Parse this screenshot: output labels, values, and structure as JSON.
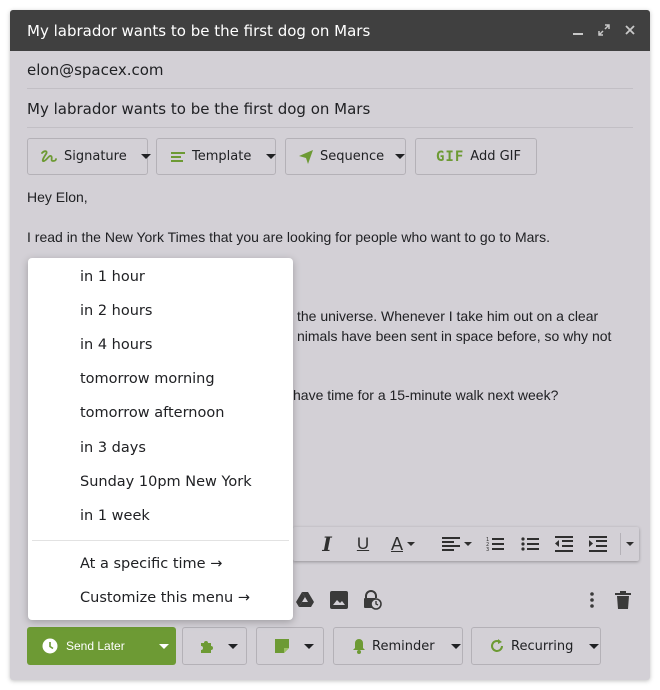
{
  "window": {
    "title": "My labrador wants to be the first dog on Mars",
    "controls": [
      "minimize-icon",
      "expand-icon",
      "close-icon"
    ]
  },
  "compose": {
    "to": "elon@spacex.com",
    "subject": "My labrador wants to be the first dog on Mars"
  },
  "toolbar": {
    "signature_label": "Signature",
    "template_label": "Template",
    "sequence_label": "Sequence",
    "gif_badge": "GIF",
    "add_gif_label": "Add GIF"
  },
  "body": {
    "greeting": "Hey Elon,",
    "line1": "I read in the New York Times that you are looking for people who want to go to Mars.",
    "line2_visible": "the universe. Whenever I take him out on a clear",
    "line3_visible": "nimals have been sent in space before, so why not",
    "line4_visible": "have time for a 15-minute walk next week?"
  },
  "send_later_menu": {
    "items": [
      "in 1 hour",
      "in 2 hours",
      "in 4 hours",
      "tomorrow morning",
      "tomorrow afternoon",
      "in 3 days",
      "Sunday 10pm New York",
      "in 1 week"
    ],
    "specific_time": "At a specific time →",
    "customize": "Customize this menu →"
  },
  "formatting_bar": {
    "icons": [
      "italic-icon",
      "underline-icon",
      "text-color-icon",
      "align-icon",
      "numbered-list-icon",
      "bulleted-list-icon",
      "indent-less-icon",
      "indent-more-icon",
      "more-formatting-icon"
    ]
  },
  "bottom_bar": {
    "send_later_label": "Send Later",
    "reminder_label": "Reminder",
    "recurring_label": "Recurring"
  },
  "colors": {
    "accent_green": "#6d9a34",
    "titlebar": "#404040",
    "dimmed_background": "#d3d0d6"
  }
}
